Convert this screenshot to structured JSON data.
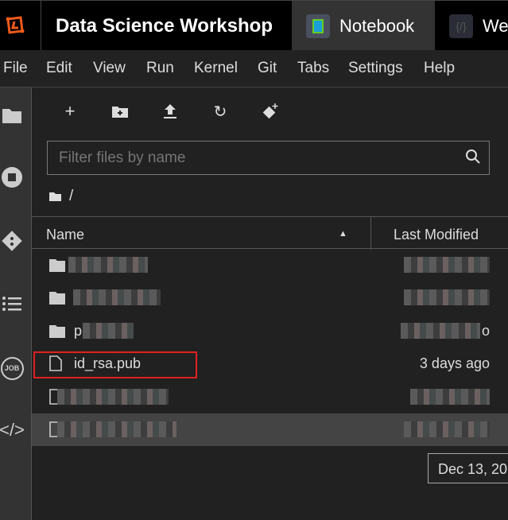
{
  "titlebar": {
    "app_title": "Data Science Workshop",
    "tabs": [
      {
        "label": "Notebook",
        "active": true
      },
      {
        "label": "We",
        "active": false
      }
    ]
  },
  "menu": [
    "File",
    "Edit",
    "View",
    "Run",
    "Kernel",
    "Git",
    "Tabs",
    "Settings",
    "Help"
  ],
  "toolbar": {
    "icons": [
      "new-launcher-icon",
      "new-folder-icon",
      "upload-icon",
      "refresh-icon",
      "git-clone-icon"
    ]
  },
  "sidebar": {
    "icons": [
      "folder-icon",
      "stop-icon",
      "git-icon",
      "toc-icon",
      "job-icon",
      "code-icon"
    ]
  },
  "filter": {
    "placeholder": "Filter files by name"
  },
  "breadcrumb": {
    "path": "/"
  },
  "table": {
    "col_name": "Name",
    "col_modified": "Last Modified",
    "sort": "ascending",
    "rows": [
      {
        "type": "folder",
        "name": "",
        "modified": ""
      },
      {
        "type": "folder",
        "name": "",
        "modified": ""
      },
      {
        "type": "folder",
        "name": "p",
        "modified": "o"
      },
      {
        "type": "file",
        "name": "id_rsa.pub",
        "modified": "3 days ago",
        "highlighted": true
      },
      {
        "type": "file",
        "name": "",
        "modified": ""
      },
      {
        "type": "file",
        "name": "",
        "modified": "",
        "selected": true
      }
    ]
  },
  "tooltip": "Dec 13, 20",
  "colors": {
    "accent_orange": "#f05a1a",
    "highlight_box": "#e02020"
  }
}
